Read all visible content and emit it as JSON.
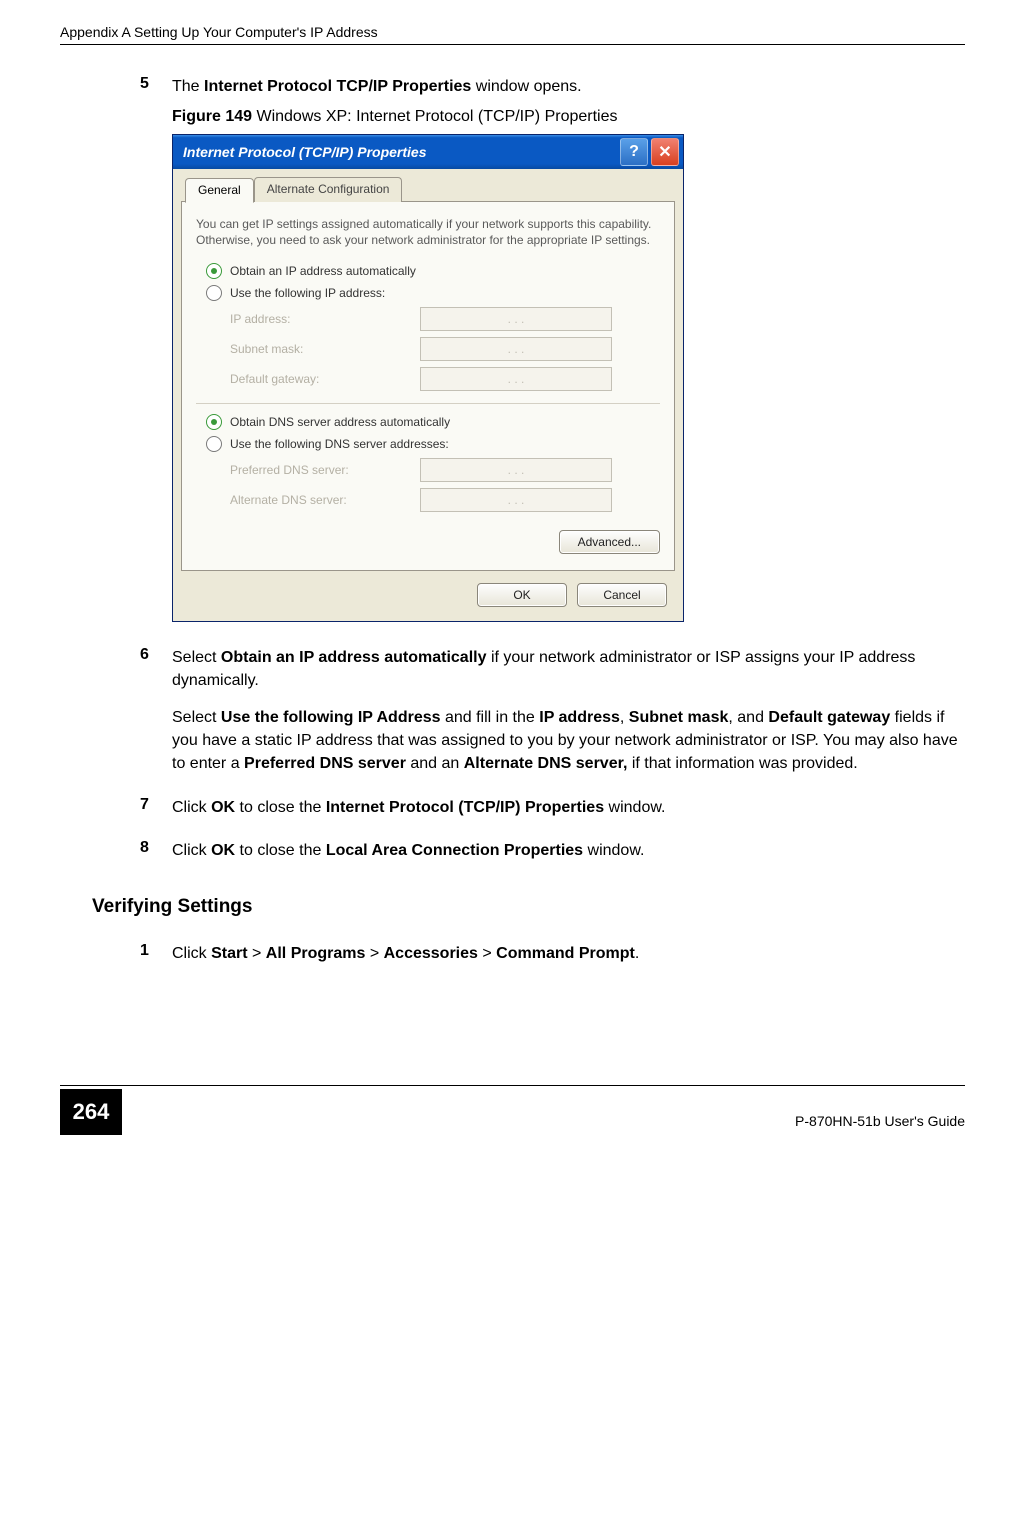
{
  "header": {
    "running_head": "Appendix A Setting Up Your Computer's IP Address"
  },
  "steps": {
    "s5_num": "5",
    "s5_pre": "The ",
    "s5_bold": "Internet Protocol TCP/IP Properties",
    "s5_post": " window opens.",
    "fig_label": "Figure 149",
    "fig_caption": "   Windows XP: Internet Protocol (TCP/IP) Properties",
    "s6_num": "6",
    "s6_pre": "Select ",
    "s6_bold": "Obtain an IP address automatically",
    "s6_post": " if your network administrator or ISP assigns your IP address dynamically.",
    "s6b_t1": "Select ",
    "s6b_b1": "Use the following IP Address",
    "s6b_t2": " and fill in the ",
    "s6b_b2": "IP address",
    "s6b_t3": ", ",
    "s6b_b3": "Subnet mask",
    "s6b_t4": ", and ",
    "s6b_b4": "Default gateway",
    "s6b_t5": " fields if you have a static IP address that was assigned to you by your network administrator or ISP. You may also have to enter a ",
    "s6b_b5": "Preferred DNS server",
    "s6b_t6": " and an ",
    "s6b_b6": "Alternate DNS server,",
    "s6b_t7": " if that information was provided.",
    "s7_num": "7",
    "s7_t1": "Click ",
    "s7_b1": "OK",
    "s7_t2": " to close the ",
    "s7_b2": "Internet Protocol (TCP/IP) Properties",
    "s7_t3": " window.",
    "s8_num": "8",
    "s8_t1": "Click ",
    "s8_b1": "OK",
    "s8_t2": " to close the ",
    "s8_b2": "Local Area Connection Properties",
    "s8_t3": " window."
  },
  "verify": {
    "heading": "Verifying Settings",
    "s1_num": "1",
    "s1_t1": "Click ",
    "s1_b1": "Start",
    "s1_t2": " > ",
    "s1_b2": "All Programs",
    "s1_t3": " > ",
    "s1_b3": "Accessories",
    "s1_t4": " > ",
    "s1_b4": "Command Prompt",
    "s1_t5": "."
  },
  "dialog": {
    "title": "Internet Protocol (TCP/IP) Properties",
    "help": "?",
    "close": "✕",
    "tab_general": "General",
    "tab_alt": "Alternate Configuration",
    "intro": "You can get IP settings assigned automatically if your network supports this capability. Otherwise, you need to ask your network administrator for the appropriate IP settings.",
    "r_auto_ip": "Obtain an IP address automatically",
    "r_use_ip": "Use the following IP address:",
    "f_ip": "IP address:",
    "f_mask": "Subnet mask:",
    "f_gw": "Default gateway:",
    "r_auto_dns": "Obtain DNS server address automatically",
    "r_use_dns": "Use the following DNS server addresses:",
    "f_pref": "Preferred DNS server:",
    "f_alt": "Alternate DNS server:",
    "ip_placeholder": ".       .       .",
    "btn_adv": "Advanced...",
    "btn_ok": "OK",
    "btn_cancel": "Cancel"
  },
  "footer": {
    "page_num": "264",
    "guide": "P-870HN-51b User's Guide"
  }
}
